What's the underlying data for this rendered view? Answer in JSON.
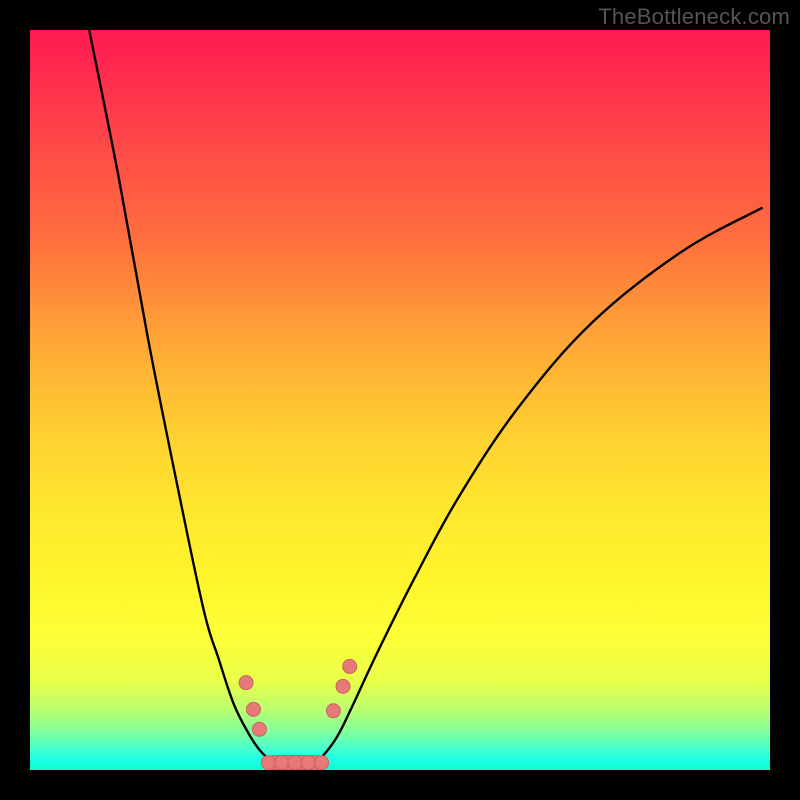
{
  "watermark": "TheBottleneck.com",
  "chart_data": {
    "type": "line",
    "title": "",
    "xlabel": "",
    "ylabel": "",
    "xlim": [
      0,
      1
    ],
    "ylim": [
      0,
      1
    ],
    "grid": false,
    "legend_position": "none",
    "series": [
      {
        "name": "left-curve",
        "x": [
          0.08,
          0.12,
          0.16,
          0.2,
          0.235,
          0.255,
          0.275,
          0.295,
          0.312,
          0.33
        ],
        "values": [
          1.0,
          0.8,
          0.58,
          0.38,
          0.215,
          0.15,
          0.09,
          0.05,
          0.025,
          0.01
        ]
      },
      {
        "name": "right-curve",
        "x": [
          0.395,
          0.415,
          0.435,
          0.47,
          0.52,
          0.58,
          0.66,
          0.76,
          0.88,
          0.99
        ],
        "values": [
          0.018,
          0.045,
          0.085,
          0.16,
          0.26,
          0.37,
          0.49,
          0.605,
          0.7,
          0.76
        ]
      }
    ],
    "valley_flat": {
      "x_start": 0.33,
      "x_end": 0.395,
      "y": 0.01
    },
    "markers": [
      {
        "name": "left-marker-1",
        "x": 0.292,
        "y": 0.118
      },
      {
        "name": "left-marker-2",
        "x": 0.302,
        "y": 0.082
      },
      {
        "name": "left-marker-3",
        "x": 0.31,
        "y": 0.055
      },
      {
        "name": "right-marker-1",
        "x": 0.41,
        "y": 0.08
      },
      {
        "name": "right-marker-2",
        "x": 0.423,
        "y": 0.113
      },
      {
        "name": "right-marker-3",
        "x": 0.432,
        "y": 0.14
      }
    ],
    "valley_markers_x": [
      0.322,
      0.34,
      0.358,
      0.376,
      0.394
    ],
    "colors": {
      "curve": "#000000",
      "marker_fill": "#e77a78",
      "marker_stroke": "#c96360"
    }
  }
}
